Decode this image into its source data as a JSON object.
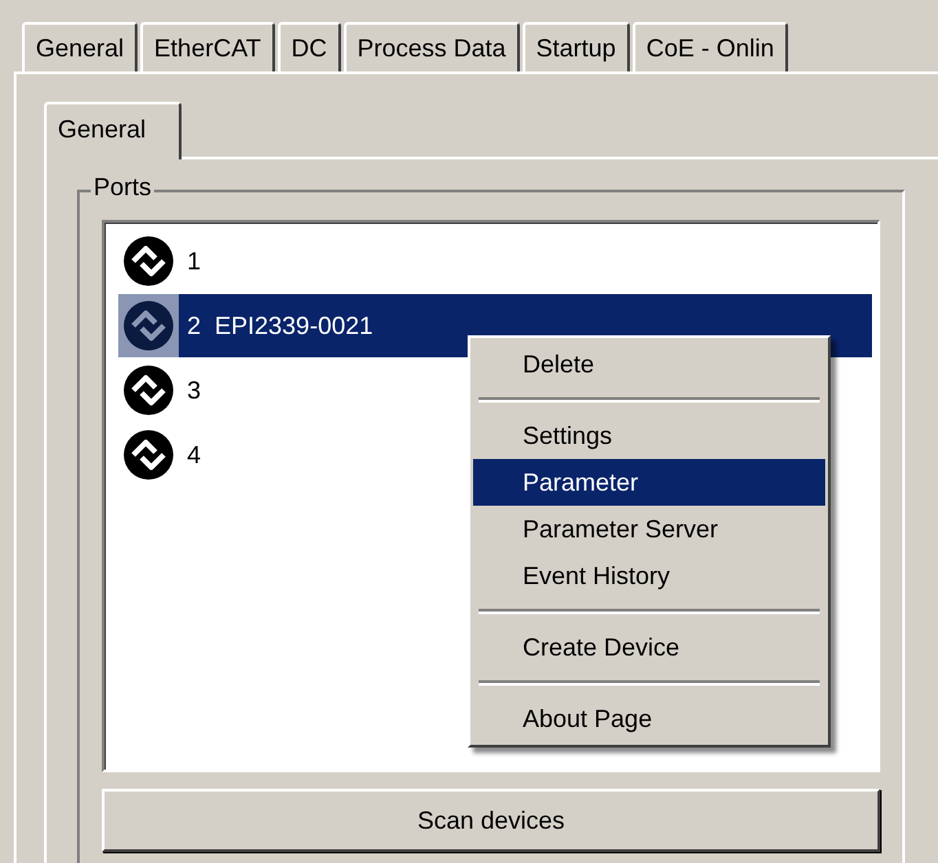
{
  "tabs": [
    {
      "label": "General",
      "selected": false
    },
    {
      "label": "EtherCAT",
      "selected": false
    },
    {
      "label": "DC",
      "selected": false
    },
    {
      "label": "Process Data",
      "selected": false
    },
    {
      "label": "Startup",
      "selected": false
    },
    {
      "label": "CoE - Onlin",
      "selected": false
    }
  ],
  "inner_tabs": [
    {
      "label": "General",
      "selected": true
    }
  ],
  "ports": {
    "title": "Ports",
    "items": [
      {
        "label": "1",
        "selected": false
      },
      {
        "label": "2  EPI2339-0021",
        "selected": true
      },
      {
        "label": "3",
        "selected": false
      },
      {
        "label": "4",
        "selected": false
      }
    ]
  },
  "context_menu": [
    {
      "kind": "item",
      "label": "Delete",
      "selected": false
    },
    {
      "kind": "separator"
    },
    {
      "kind": "item",
      "label": "Settings",
      "selected": false
    },
    {
      "kind": "item",
      "label": "Parameter",
      "selected": true
    },
    {
      "kind": "item",
      "label": "Parameter Server",
      "selected": false
    },
    {
      "kind": "item",
      "label": "Event History",
      "selected": false
    },
    {
      "kind": "separator"
    },
    {
      "kind": "item",
      "label": "Create Device",
      "selected": false
    },
    {
      "kind": "separator"
    },
    {
      "kind": "item",
      "label": "About Page",
      "selected": false
    }
  ],
  "scan_button": "Scan devices"
}
